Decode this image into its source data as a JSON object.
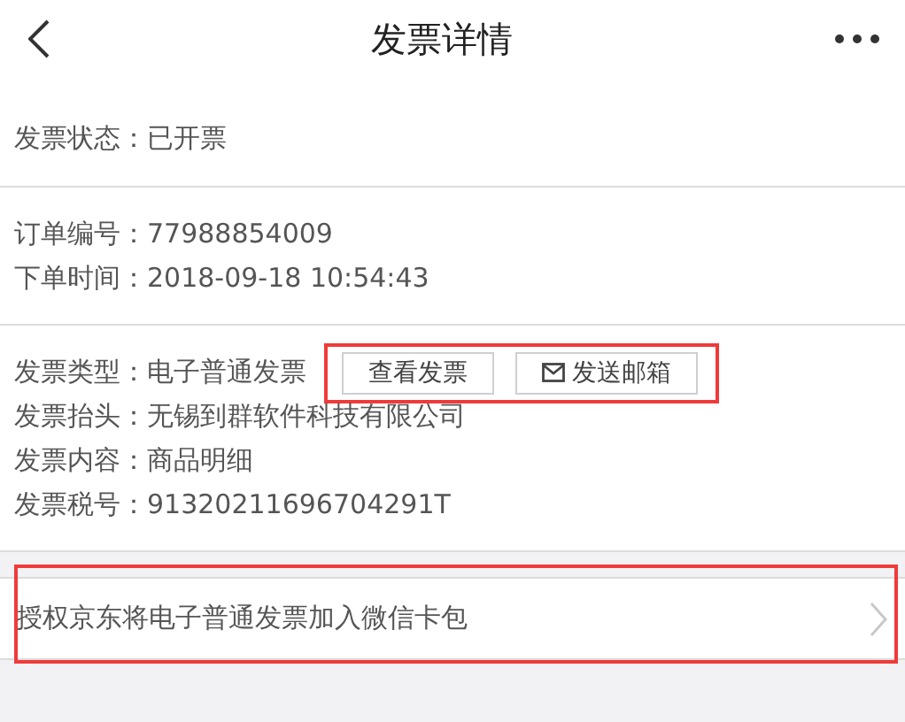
{
  "header": {
    "title": "发票详情"
  },
  "sections": [
    {
      "lines": [
        {
          "text": "发票状态：已开票"
        }
      ]
    },
    {
      "lines": [
        {
          "text": "订单编号：77988854009"
        },
        {
          "text": "下单时间：2018-09-18 10:54:43"
        }
      ]
    },
    {
      "lines": [
        {
          "text": "发票类型：电子普通发票",
          "buttons": [
            {
              "kind": "plain",
              "label": "查看发票"
            },
            {
              "kind": "mail",
              "label": "发送邮箱"
            }
          ]
        },
        {
          "text": "发票抬头：无锡到群软件科技有限公司"
        },
        {
          "text": "发票内容：商品明细"
        },
        {
          "text": "发票税号：91320211696704291T"
        }
      ]
    }
  ],
  "wechat_row": {
    "label": "授权京东将电子普通发票加入微信卡包"
  }
}
